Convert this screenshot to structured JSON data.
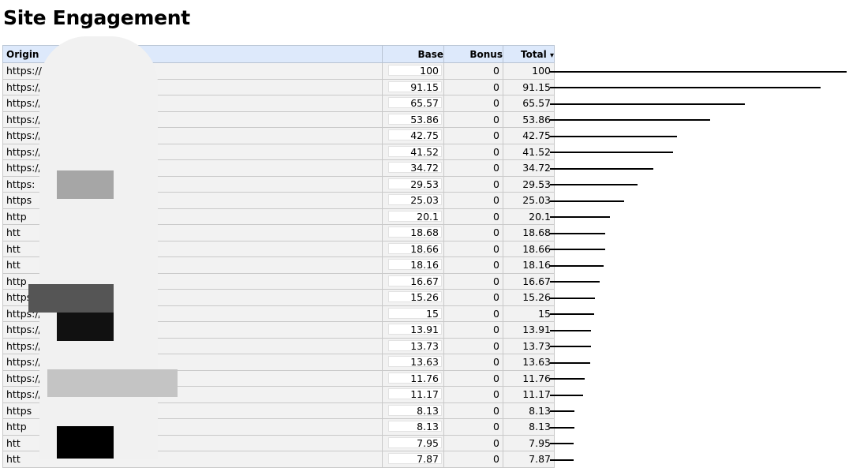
{
  "page": {
    "title": "Site Engagement"
  },
  "table": {
    "headers": {
      "origin": "Origin",
      "base": "Base",
      "bonus": "Bonus",
      "total": "Total",
      "sort_indicator": "▾"
    },
    "rows": [
      {
        "origin": "https://",
        "base": "100",
        "bonus": "0",
        "total": "100",
        "value": 100
      },
      {
        "origin": "https://",
        "base": "91.15",
        "bonus": "0",
        "total": "91.15",
        "value": 91.15
      },
      {
        "origin": "https://",
        "base": "65.57",
        "bonus": "0",
        "total": "65.57",
        "value": 65.57
      },
      {
        "origin": "https://",
        "base": "53.86",
        "bonus": "0",
        "total": "53.86",
        "value": 53.86
      },
      {
        "origin": "https://",
        "base": "42.75",
        "bonus": "0",
        "total": "42.75",
        "value": 42.75
      },
      {
        "origin": "https://",
        "base": "41.52",
        "bonus": "0",
        "total": "41.52",
        "value": 41.52
      },
      {
        "origin": "https://",
        "base": "34.72",
        "bonus": "0",
        "total": "34.72",
        "value": 34.72
      },
      {
        "origin": "https:",
        "base": "29.53",
        "bonus": "0",
        "total": "29.53",
        "value": 29.53
      },
      {
        "origin": "https",
        "base": "25.03",
        "bonus": "0",
        "total": "25.03",
        "value": 25.03
      },
      {
        "origin": "http",
        "base": "20.1",
        "bonus": "0",
        "total": "20.1",
        "value": 20.1
      },
      {
        "origin": "htt",
        "base": "18.68",
        "bonus": "0",
        "total": "18.68",
        "value": 18.68
      },
      {
        "origin": "htt",
        "base": "18.66",
        "bonus": "0",
        "total": "18.66",
        "value": 18.66
      },
      {
        "origin": "htt",
        "base": "18.16",
        "bonus": "0",
        "total": "18.16",
        "value": 18.16
      },
      {
        "origin": "http",
        "base": "16.67",
        "bonus": "0",
        "total": "16.67",
        "value": 16.67
      },
      {
        "origin": "https",
        "base": "15.26",
        "bonus": "0",
        "total": "15.26",
        "value": 15.26
      },
      {
        "origin": "https://",
        "base": "15",
        "bonus": "0",
        "total": "15",
        "value": 15
      },
      {
        "origin": "https://s",
        "base": "13.91",
        "bonus": "0",
        "total": "13.91",
        "value": 13.91
      },
      {
        "origin": "https://",
        "base": "13.73",
        "bonus": "0",
        "total": "13.73",
        "value": 13.73
      },
      {
        "origin": "https://c",
        "base": "13.63",
        "bonus": "0",
        "total": "13.63",
        "value": 13.63
      },
      {
        "origin": "https://se",
        "base": "11.76",
        "bonus": "0",
        "total": "11.76",
        "value": 11.76
      },
      {
        "origin": "https://ww",
        "base": "11.17",
        "bonus": "0",
        "total": "11.17",
        "value": 11.17
      },
      {
        "origin": "https",
        "base": "8.13",
        "bonus": "0",
        "total": "8.13",
        "value": 8.13
      },
      {
        "origin": "http",
        "base": "8.13",
        "bonus": "0",
        "total": "8.13",
        "value": 8.13
      },
      {
        "origin": "htt",
        "base": "7.95",
        "bonus": "0",
        "total": "7.95",
        "value": 7.95
      },
      {
        "origin": "htt",
        "base": "7.87",
        "bonus": "0",
        "total": "7.87",
        "value": 7.87
      }
    ]
  }
}
